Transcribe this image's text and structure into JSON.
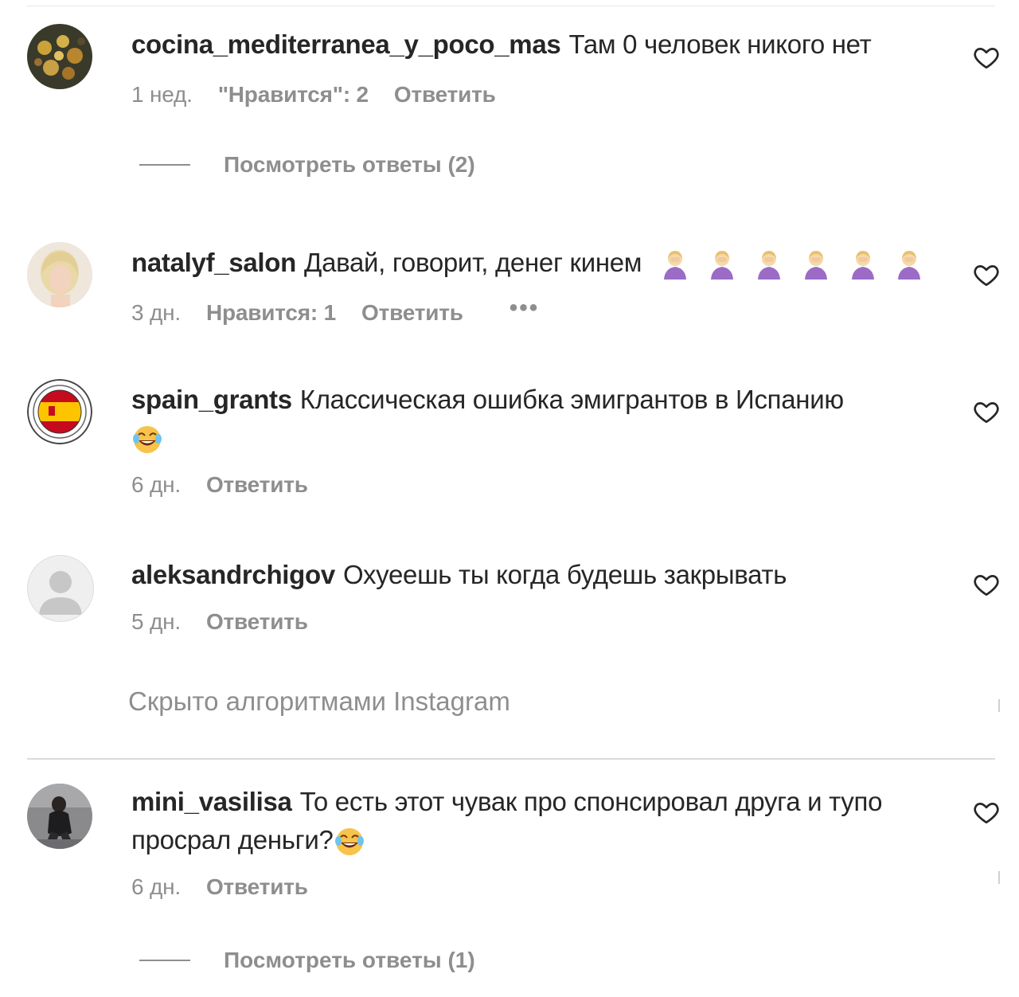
{
  "comments": [
    {
      "username": "cocina_mediterranea_y_poco_mas",
      "text": "Там 0 человек никого нет",
      "time": "1 нед.",
      "likes": "\"Нравится\": 2",
      "reply": "Ответить",
      "view_replies": "Посмотреть ответы (2)"
    },
    {
      "username": "natalyf_salon",
      "text": "Давай, говорит, денег кинем",
      "time": "3 дн.",
      "likes": "Нравится: 1",
      "reply": "Ответить",
      "more": "•••"
    },
    {
      "username": "spain_grants",
      "text": "Классическая ошибка эмигрантов в Испанию",
      "time": "6 дн.",
      "reply": "Ответить"
    },
    {
      "username": "aleksandrchigov",
      "text": "Охуеешь ты когда будешь закрывать",
      "time": "5 дн.",
      "reply": "Ответить"
    },
    {
      "username": "mini_vasilisa",
      "text": "То есть этот чувак про спонсировал друга и тупо просрал деньги?",
      "time": "6 дн.",
      "reply": "Ответить",
      "view_replies": "Посмотреть ответы (1)"
    }
  ],
  "hidden_label": "Скрыто алгоритмами Instagram",
  "icons": {
    "like": "heart-outline-icon",
    "laugh": "rolling-laughing-emoji",
    "facepalm": "woman-facepalming-emoji"
  },
  "colors": {
    "text": "#262626",
    "secondary": "#8e8e8e",
    "divider": "#dbdbdb"
  }
}
